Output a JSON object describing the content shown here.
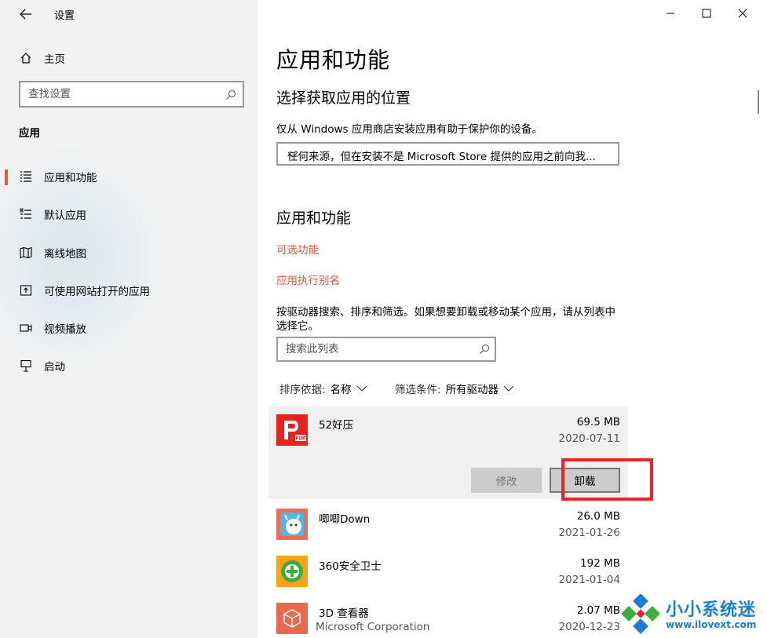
{
  "window": {
    "title": "设置",
    "controls": {
      "minimize": "minimize-icon",
      "maximize": "maximize-icon",
      "close": "close-icon"
    }
  },
  "sidebar": {
    "home_label": "主页",
    "search_placeholder": "查找设置",
    "section_title": "应用",
    "items": [
      {
        "label": "应用和功能",
        "icon": "apps-features-icon",
        "active": true
      },
      {
        "label": "默认应用",
        "icon": "default-apps-icon",
        "active": false
      },
      {
        "label": "离线地图",
        "icon": "offline-maps-icon",
        "active": false
      },
      {
        "label": "可使用网站打开的应用",
        "icon": "apps-for-websites-icon",
        "active": false
      },
      {
        "label": "视频播放",
        "icon": "video-playback-icon",
        "active": false
      },
      {
        "label": "启动",
        "icon": "startup-icon",
        "active": false
      }
    ]
  },
  "main": {
    "page_title": "应用和功能",
    "source_section": {
      "title": "选择获取应用的位置",
      "description": "仅从 Windows 应用商店安装应用有助于保护你的设备。",
      "dropdown_value": "任何来源，但在安装不是 Microsoft Store 提供的应用之前向我..."
    },
    "apps_section": {
      "title": "应用和功能",
      "link_optional": "可选功能",
      "link_alias": "应用执行别名",
      "description_line1": "按驱动器搜索、排序和筛选。如果想要卸载或移动某个应用，请从列表中",
      "description_line2": "选择它。",
      "search_placeholder": "搜索此列表",
      "sort_label": "排序依据:",
      "sort_value": "名称",
      "filter_label": "筛选条件:",
      "filter_value": "所有驱动器"
    },
    "apps": [
      {
        "name": "52好压",
        "publisher": "",
        "size": "69.5 MB",
        "date": "2020-07-11",
        "icon": "haozip-icon",
        "selected": true
      },
      {
        "name": "唧唧Down",
        "publisher": "",
        "size": "26.0 MB",
        "date": "2021-01-26",
        "icon": "jijidown-icon",
        "selected": false
      },
      {
        "name": "360安全卫士",
        "publisher": "",
        "size": "192 MB",
        "date": "2021-01-04",
        "icon": "360-security-icon",
        "selected": false
      },
      {
        "name": "3D 查看器",
        "publisher": "Microsoft Corporation",
        "size": "2.07 MB",
        "date": "2020-12-23",
        "icon": "3d-viewer-icon",
        "selected": false
      }
    ],
    "buttons": {
      "modify": "修改",
      "uninstall": "卸载"
    }
  },
  "watermark": {
    "brand": "小小系统迷",
    "url": "www.ilovext.com"
  },
  "colors": {
    "accent": "#e05a47",
    "highlight_box": "#e8232a",
    "watermark": "#1a7fd4"
  }
}
